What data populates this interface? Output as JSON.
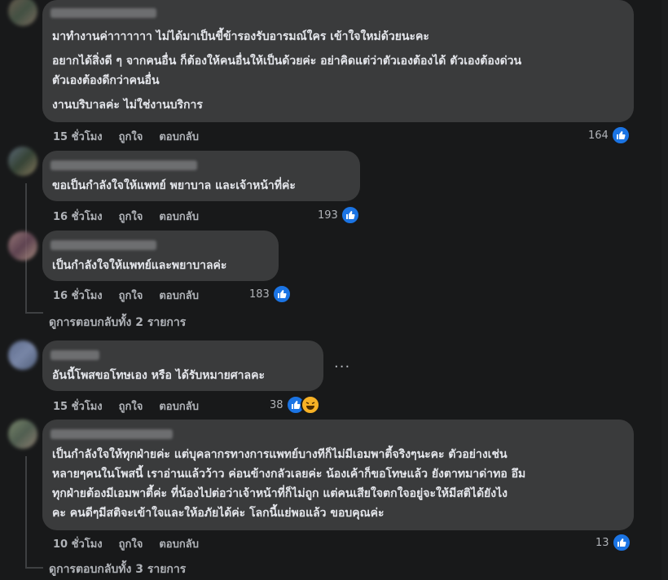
{
  "comments": [
    {
      "lines": [
        "มาทำงานค่าาาาาาา ไม่ได้มาเป็นขี้ข้ารองรับอารมณ์ใคร เข้าใจใหม่ด้วยนะคะ",
        "อยากได้สิ่งดี ๆ จากคนอื่น ก็ต้องให้คนอื่นให้เป็นด้วยค่ะ อย่าคิดแต่ว่าตัวเองต้องได้ ตัวเองต้องด่วน",
        "ตัวเองต้องดีกว่าคนอื่น",
        "งานบริบาลค่ะ ไม่ใช่งานบริการ"
      ],
      "time": "15 ชั่วโมง",
      "like": "ถูกใจ",
      "reply": "ตอบกลับ",
      "count": "164"
    },
    {
      "lines": [
        "ขอเป็นกำลังใจให้แพทย์ พยาบาล และเจ้าหน้าที่ค่ะ"
      ],
      "time": "16 ชั่วโมง",
      "like": "ถูกใจ",
      "reply": "ตอบกลับ",
      "count": "193"
    },
    {
      "lines": [
        "เป็นกำลังใจให้แพทย์และพยาบาลค่ะ"
      ],
      "time": "16 ชั่วโมง",
      "like": "ถูกใจ",
      "reply": "ตอบกลับ",
      "count": "183"
    },
    {
      "lines": [
        "อันนี้โพสขอโทษเอง หรือ ได้รับหมายศาลคะ"
      ],
      "time": "15 ชั่วโมง",
      "like": "ถูกใจ",
      "reply": "ตอบกลับ",
      "count": "38"
    },
    {
      "lines": [
        "เป็นกำลังใจให้ทุกฝ่ายค่ะ แต่บุคลากรทางการแพทย์บางทีก็ไม่มีเอมพาตี้จริงๆนะคะ ตัวอย่างเช่น",
        "หลายๆคนในโพสนี้ เราอ่านแล้วว้าว ค่อนข้างกลัวเลยค่ะ น้องเค้าก็ขอโทษแล้ว ยังตาทมาด่าทอ อึม",
        "ทุกฝ่ายต้องมีเอมพาตี้ค่ะ ที่น้องไปต่อว่าเจ้าหน้าที่ก็ไม่ถูก แต่คนเสียใจตกใจอยู่จะให้มีสติได้ยังไง",
        "คะ คนดีๆมีสติจะเข้าใจและให้อภัยได้ค่ะ โลกนี้แย่พอแล้ว ขอบคุณค่ะ"
      ],
      "time": "10 ชั่วโมง",
      "like": "ถูกใจ",
      "reply": "ตอบกลับ",
      "count": "13"
    }
  ],
  "view_replies_1": "ดูการตอบกลับทั้ง 2 รายการ",
  "view_replies_2": "ดูการตอบกลับทั้ง 3 รายการ",
  "more_options": "···",
  "colors": {
    "bg": "#18191a",
    "bubble": "#3a3b3c",
    "like": "#1b74e4",
    "meta": "#b0b3b8"
  }
}
